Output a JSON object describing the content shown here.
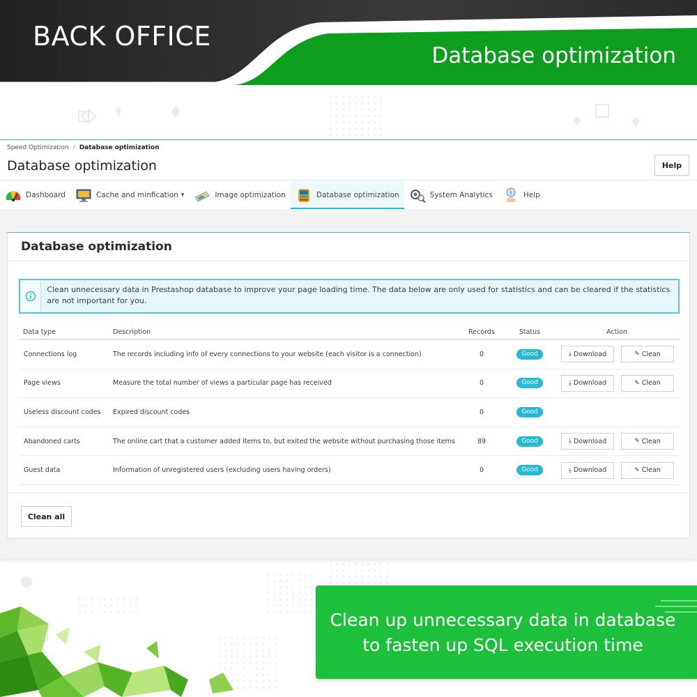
{
  "banner": {
    "title": "BACK OFFICE",
    "subtitle": "Database optimization"
  },
  "breadcrumb": {
    "parent": "Speed Optimization",
    "separator": "/",
    "current": "Database optimization"
  },
  "page": {
    "title": "Database optimization",
    "help_label": "Help"
  },
  "tabs": [
    {
      "label": "Dashboard",
      "icon": "gauge-icon"
    },
    {
      "label": "Cache and minfication",
      "icon": "monitor-icon"
    },
    {
      "label": "Image optimization",
      "icon": "image-icon"
    },
    {
      "label": "Database optimization",
      "icon": "database-icon",
      "active": true
    },
    {
      "label": "System Analytics",
      "icon": "analytics-icon"
    },
    {
      "label": "Help",
      "icon": "help-icon"
    }
  ],
  "card": {
    "title": "Database optimization",
    "alert": "Clean unnecessary data in Prestashop database to improve your page loading time. The data below are only used for statistics and can be cleared if the statistics are not important for you."
  },
  "table": {
    "headers": {
      "type": "Data type",
      "description": "Description",
      "records": "Records",
      "status": "Status",
      "action": "Action"
    },
    "rows": [
      {
        "type": "Connections log",
        "description": "The records including info of every connections to your website (each visitor is a connection)",
        "records": "0",
        "status": "Good",
        "download": "Download",
        "clean": "Clean"
      },
      {
        "type": "Page views",
        "description": "Measure the total number of views a particular page has received",
        "records": "0",
        "status": "Good",
        "download": "Download",
        "clean": "Clean"
      },
      {
        "type": "Useless discount codes",
        "description": "Expired discount codes",
        "records": "0",
        "status": "Good"
      },
      {
        "type": "Abandoned carts",
        "description": "The online cart that a customer added items to, but exited the website without purchasing those items",
        "records": "89",
        "status": "Good",
        "download": "Download",
        "clean": "Clean"
      },
      {
        "type": "Guest data",
        "description": "Information of unregistered users (excluding users having orders)",
        "records": "0",
        "status": "Good",
        "download": "Download",
        "clean": "Clean"
      }
    ]
  },
  "clean_all_label": "Clean all",
  "callout": {
    "line1": "Clean up unnecessary data in database",
    "line2": "to fasten up SQL execution time"
  },
  "colors": {
    "banner_dark": "#2f2f2f",
    "banner_green": "#0e9e1e",
    "accent": "#25b9d7",
    "callout_green": "#1dc03a"
  }
}
